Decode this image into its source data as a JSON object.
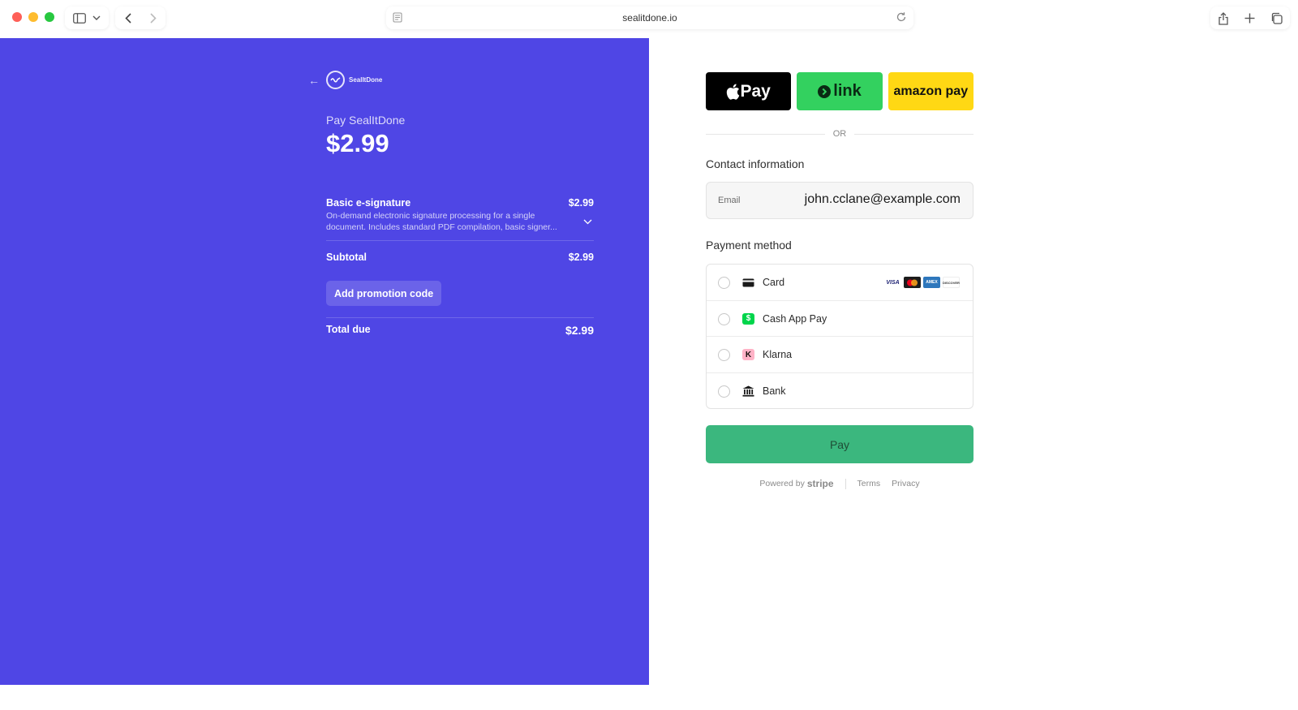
{
  "browser": {
    "url": "sealitdone.io"
  },
  "left": {
    "merchant_logo_text": "SealItDone",
    "pay_to": "Pay SealItDone",
    "amount": "$2.99",
    "line_item": {
      "name": "Basic e-signature",
      "price": "$2.99",
      "description": "On-demand electronic signature processing for a single document. Includes standard PDF compilation, basic signer..."
    },
    "subtotal_label": "Subtotal",
    "subtotal_value": "$2.99",
    "promo_label": "Add promotion code",
    "total_label": "Total due",
    "total_value": "$2.99",
    "brand_color": "#4f46e5"
  },
  "right": {
    "wallets": {
      "apple_pay": "Pay",
      "link": "link",
      "amazon_pay": "amazon pay"
    },
    "or_text": "OR",
    "contact_label": "Contact information",
    "email_label": "Email",
    "email_value": "john.cclane@example.com",
    "payment_label": "Payment method",
    "methods": [
      {
        "label": "Card",
        "icon": "credit-card-icon"
      },
      {
        "label": "Cash App Pay",
        "icon": "cash-app-icon"
      },
      {
        "label": "Klarna",
        "icon": "klarna-icon"
      },
      {
        "label": "Bank",
        "icon": "bank-icon"
      }
    ],
    "card_brands": [
      "VISA",
      "Mastercard",
      "AMEX",
      "DISCOVER"
    ],
    "pay_button": "Pay",
    "pay_button_color": "#3bb77e",
    "footer": {
      "powered_by": "Powered by",
      "stripe": "stripe",
      "terms": "Terms",
      "privacy": "Privacy"
    }
  }
}
